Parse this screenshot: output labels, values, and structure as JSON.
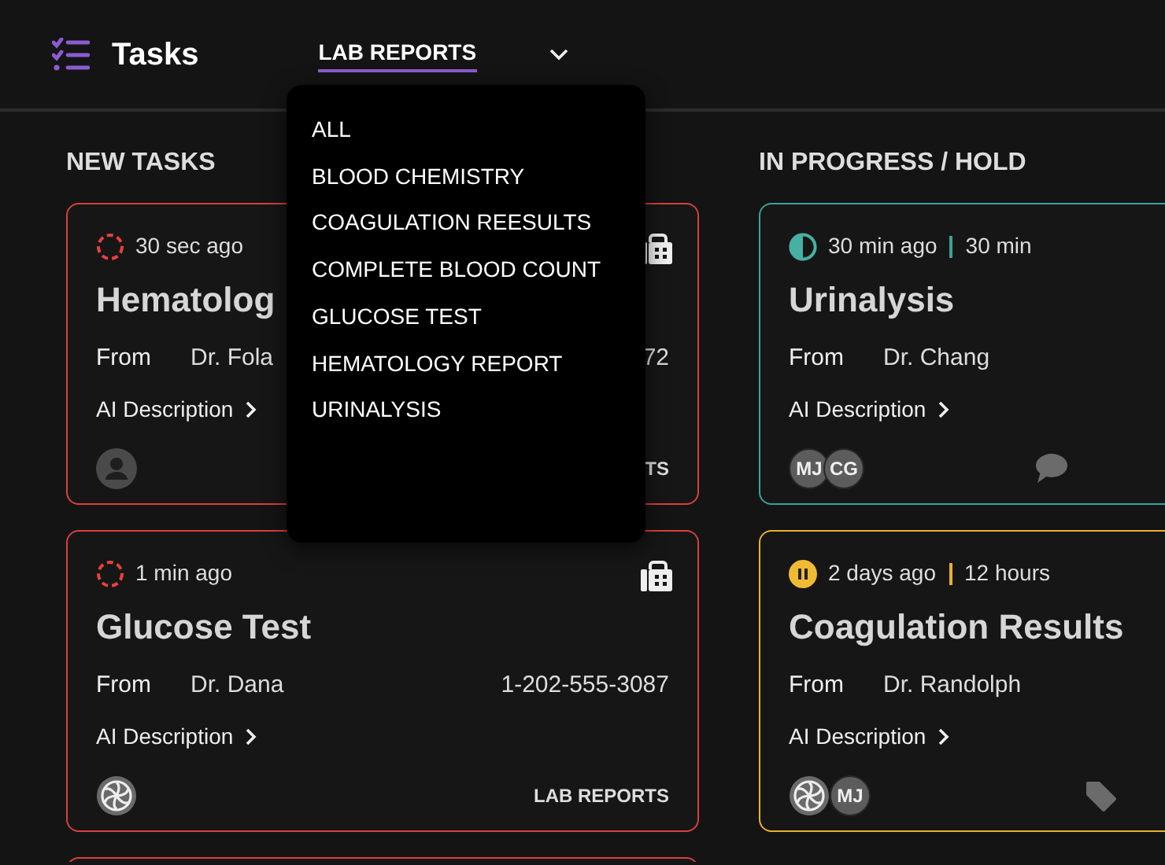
{
  "header": {
    "title": "Tasks",
    "filter": {
      "label": "LAB REPORTS",
      "expanded": true
    }
  },
  "filter_menu": {
    "items": [
      "ALL",
      "BLOOD CHEMISTRY",
      "COAGULATION REESULTS",
      "COMPLETE BLOOD COUNT",
      "GLUCOSE TEST",
      "HEMATOLOGY REPORT",
      "URINALYSIS"
    ]
  },
  "columns": [
    {
      "heading": "NEW TASKS",
      "cards": [
        {
          "kind": "new",
          "time": "30 sec ago",
          "title": "Hematolog",
          "from_label": "From",
          "sender": "Dr. Fola",
          "phone": "72",
          "ai_label": "AI Description",
          "category": "TS",
          "assignees": [
            {
              "kind": "person"
            }
          ]
        },
        {
          "kind": "new",
          "time": "1 min ago",
          "title": "Glucose Test",
          "from_label": "From",
          "sender": "Dr. Dana",
          "phone": "1-202-555-3087",
          "ai_label": "AI Description",
          "category": "LAB REPORTS",
          "assignees": [
            {
              "kind": "logo"
            }
          ]
        },
        {
          "kind": "new"
        }
      ]
    },
    {
      "heading": "IN PROGRESS / HOLD",
      "cards": [
        {
          "kind": "in_progress",
          "time": "30 min ago",
          "duration": "30 min",
          "title": "Urinalysis",
          "from_label": "From",
          "sender": "Dr. Chang",
          "ai_label": "AI Description",
          "assignees": [
            {
              "kind": "initials",
              "initials": "MJ"
            },
            {
              "kind": "initials",
              "initials": "CG"
            }
          ]
        },
        {
          "kind": "hold",
          "time": "2 days ago",
          "duration": "12 hours",
          "title": "Coagulation Results",
          "from_label": "From",
          "sender": "Dr. Randolph",
          "ai_label": "AI Description",
          "assignees": [
            {
              "kind": "logo"
            },
            {
              "kind": "initials",
              "initials": "MJ"
            }
          ]
        }
      ]
    }
  ]
}
